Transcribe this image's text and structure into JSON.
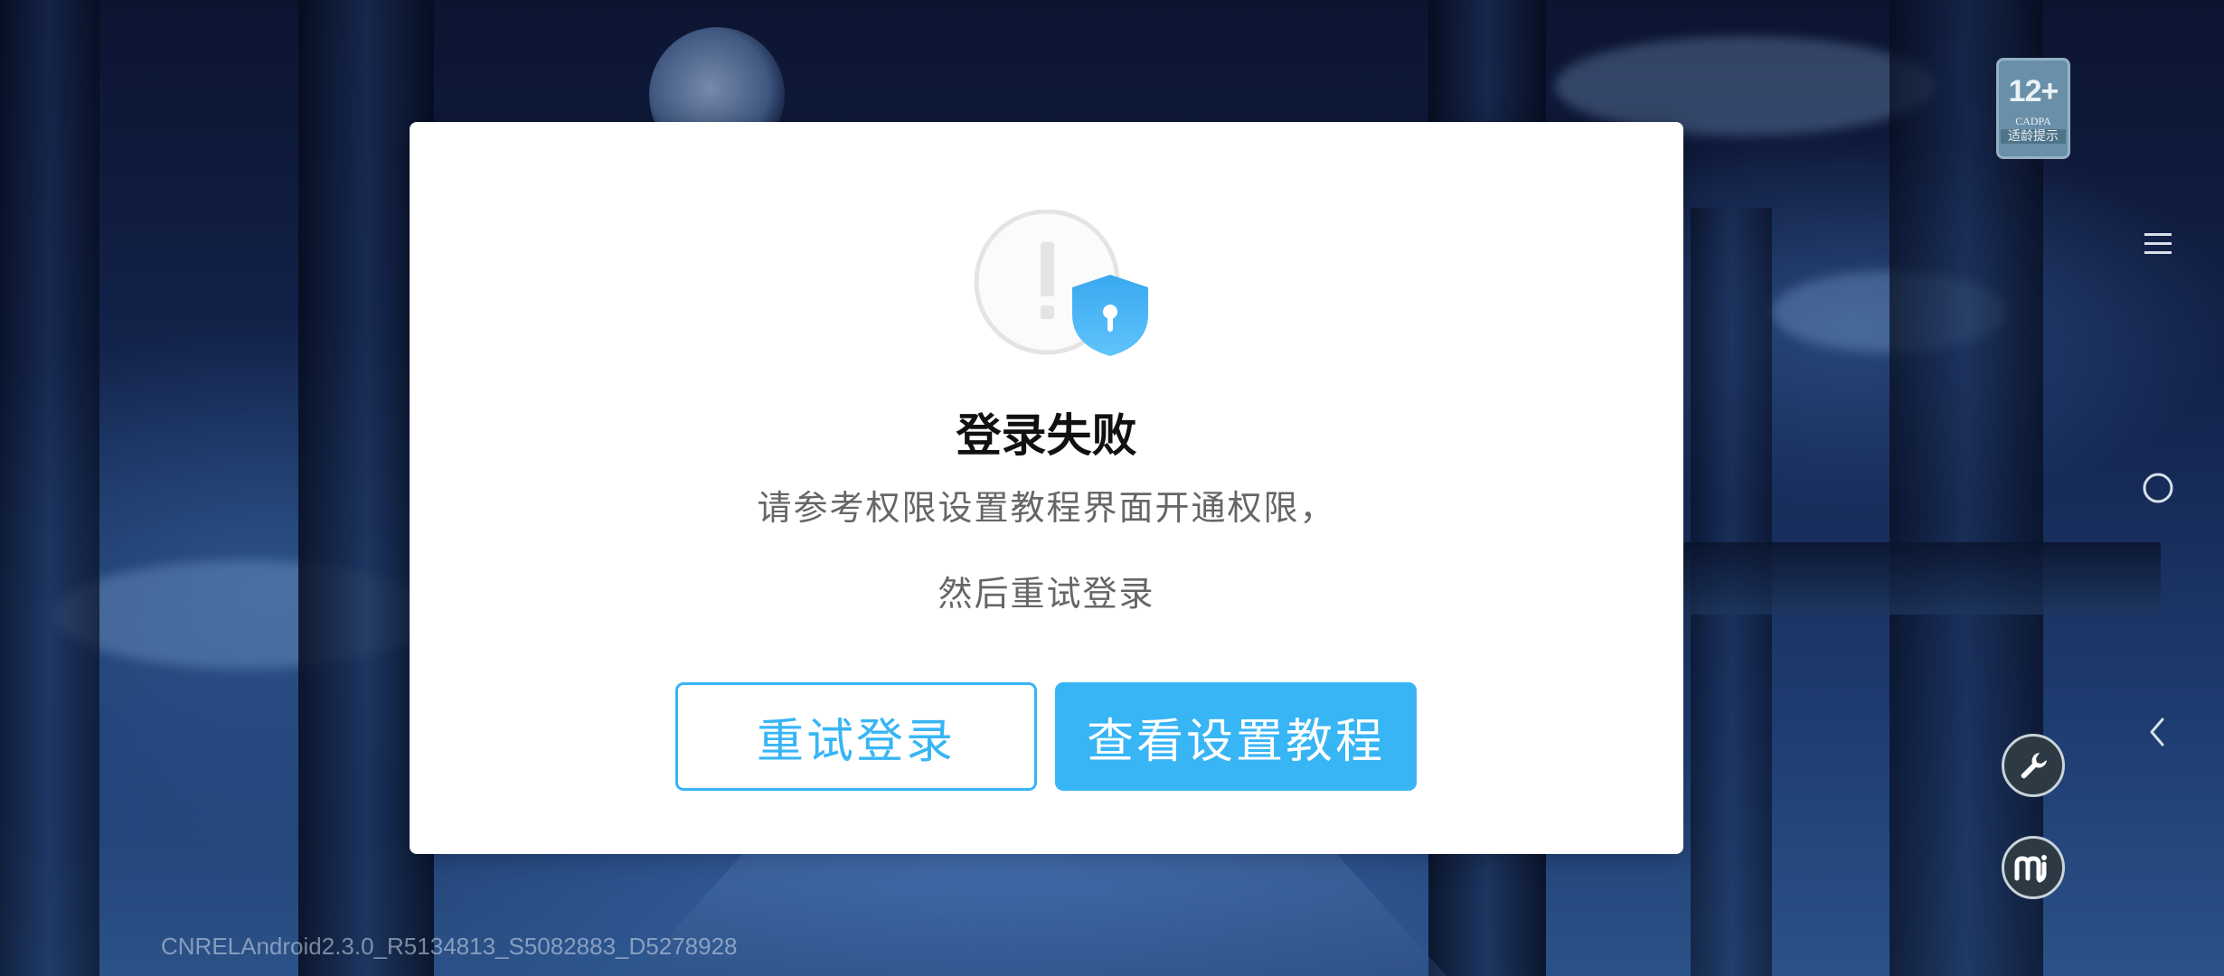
{
  "dialog": {
    "title": "登录失败",
    "message_line1": "请参考权限设置教程界面开通权限，",
    "message_line2": "然后重试登录",
    "retry_button": "重试登录",
    "tutorial_button": "查看设置教程",
    "icon": "alert-shield-icon"
  },
  "age_rating": {
    "age": "12+",
    "org": "CADPA",
    "tip": "适龄提示"
  },
  "sidebar": {
    "menu_icon": "menu-icon",
    "home_icon": "circle-home-icon",
    "back_icon": "chevron-left-icon",
    "tool_icon": "wrench-icon",
    "brand_icon": "mi-logo-icon"
  },
  "footer": {
    "version": "CNRELAndroid2.3.0_R5134813_S5082883_D5278928"
  },
  "colors": {
    "accent": "#38b5f5",
    "title": "#111111",
    "message": "#666666"
  }
}
